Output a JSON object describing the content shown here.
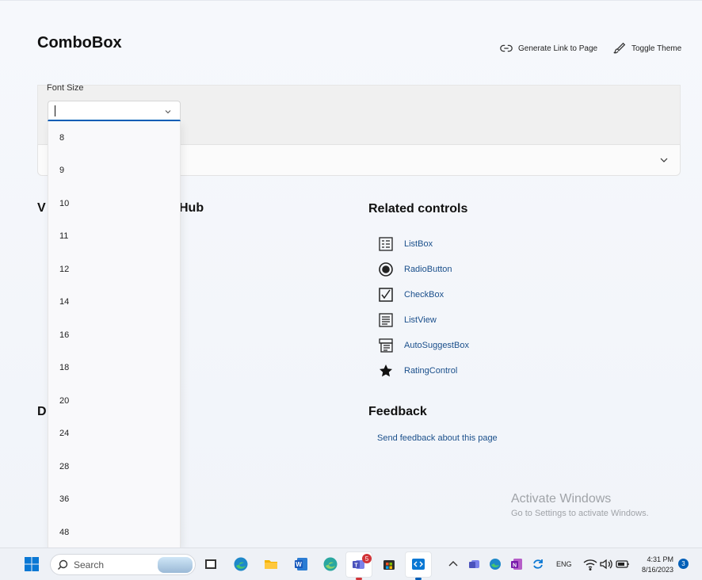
{
  "page": {
    "title": "ComboBox",
    "generate_link_label": "Generate Link to Page",
    "toggle_theme_label": "Toggle Theme"
  },
  "font_size_combo": {
    "label": "Font Size",
    "value": "",
    "options": [
      "8",
      "9",
      "10",
      "11",
      "12",
      "14",
      "16",
      "18",
      "20",
      "24",
      "28",
      "36",
      "48"
    ]
  },
  "partial_sections": {
    "left_heading_start": "V",
    "left_heading_end": "Hub",
    "docs_heading_start": "D"
  },
  "related_controls": {
    "title": "Related controls",
    "items": [
      {
        "label": "ListBox",
        "icon": "listbox-icon"
      },
      {
        "label": "RadioButton",
        "icon": "radiobutton-icon"
      },
      {
        "label": "CheckBox",
        "icon": "checkbox-icon"
      },
      {
        "label": "ListView",
        "icon": "listview-icon"
      },
      {
        "label": "AutoSuggestBox",
        "icon": "autosuggestbox-icon"
      },
      {
        "label": "RatingControl",
        "icon": "star-icon"
      }
    ]
  },
  "feedback": {
    "title": "Feedback",
    "link": "Send feedback about this page"
  },
  "watermark": {
    "line1": "Activate Windows",
    "line2": "Go to Settings to activate Windows."
  },
  "taskbar": {
    "search_placeholder": "Search",
    "teams_badge": "5",
    "language": "ENG",
    "time": "4:31 PM",
    "date": "8/16/2023",
    "notification_count": "3"
  },
  "colors": {
    "accent": "#005fb8",
    "link": "#1a4f8b"
  }
}
